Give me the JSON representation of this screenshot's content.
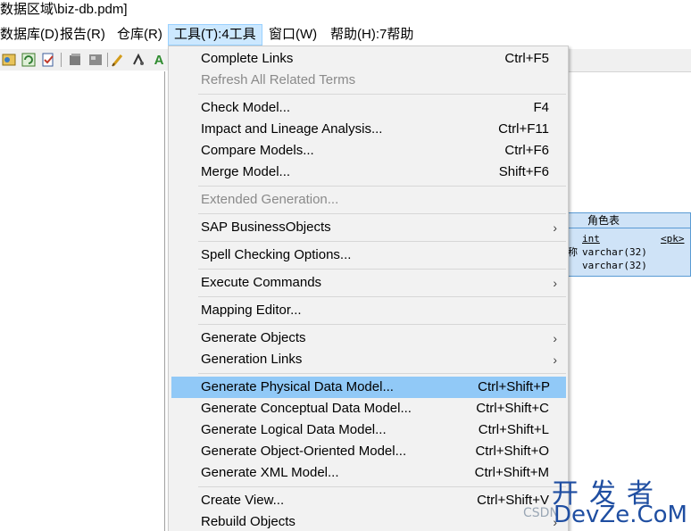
{
  "window": {
    "title": "数据区域\\biz-db.pdm]"
  },
  "menubar": {
    "items": [
      {
        "label": "数据库(D)"
      },
      {
        "label": "报告(R)"
      },
      {
        "label": "仓库(R)"
      },
      {
        "label": "工具(T):4工具"
      },
      {
        "label": "窗口(W)"
      },
      {
        "label": "帮助(H):7帮助"
      }
    ]
  },
  "toolbar": {
    "icons": [
      "database-icon",
      "refresh-icon",
      "check-icon",
      "cube-icon",
      "image-icon",
      "brush-icon",
      "link-icon",
      "text-a-icon"
    ]
  },
  "tools_menu": {
    "items": [
      {
        "label": "Complete Links",
        "shortcut": "Ctrl+F5"
      },
      {
        "label": "Refresh All Related Terms",
        "shortcut": "",
        "disabled": true
      },
      {
        "label": "Check Model...",
        "shortcut": "F4"
      },
      {
        "label": "Impact and Lineage Analysis...",
        "shortcut": "Ctrl+F11"
      },
      {
        "label": "Compare Models...",
        "shortcut": "Ctrl+F6"
      },
      {
        "label": "Merge Model...",
        "shortcut": "Shift+F6"
      },
      {
        "label": "Extended Generation...",
        "shortcut": "",
        "disabled": true
      },
      {
        "label": "SAP BusinessObjects",
        "submenu": true
      },
      {
        "label": "Spell Checking Options...",
        "shortcut": ""
      },
      {
        "label": "Execute Commands",
        "submenu": true
      },
      {
        "label": "Mapping Editor...",
        "shortcut": ""
      },
      {
        "label": "Generate Objects",
        "submenu": true
      },
      {
        "label": "Generation Links",
        "submenu": true
      },
      {
        "label": "Generate Physical Data Model...",
        "shortcut": "Ctrl+Shift+P",
        "highlighted": true
      },
      {
        "label": "Generate Conceptual Data Model...",
        "shortcut": "Ctrl+Shift+C"
      },
      {
        "label": "Generate Logical Data Model...",
        "shortcut": "Ctrl+Shift+L"
      },
      {
        "label": "Generate Object-Oriented Model...",
        "shortcut": "Ctrl+Shift+O"
      },
      {
        "label": "Generate XML Model...",
        "shortcut": "Ctrl+Shift+M"
      },
      {
        "label": "Create View...",
        "shortcut": "Ctrl+Shift+V"
      },
      {
        "label": "Rebuild Objects",
        "submenu": true
      }
    ],
    "submenu_arrow": "›"
  },
  "entity": {
    "title": "角色表",
    "rows": [
      {
        "left": "",
        "type": "int",
        "key": "<pk>"
      },
      {
        "left": "称",
        "type": "varchar(32)",
        "key": ""
      },
      {
        "left": "",
        "type": "varchar(32)",
        "key": ""
      }
    ]
  },
  "watermark": {
    "chinese": "开发者",
    "english": "DevZe.CoM",
    "csdn": "CSDN"
  },
  "colors": {
    "highlight": "#91c9f7",
    "menu_bg": "#f2f2f2",
    "active_menubar": "#cce8ff",
    "entity_bg": "#cfe3f7",
    "watermark": "#1f4ea1"
  }
}
